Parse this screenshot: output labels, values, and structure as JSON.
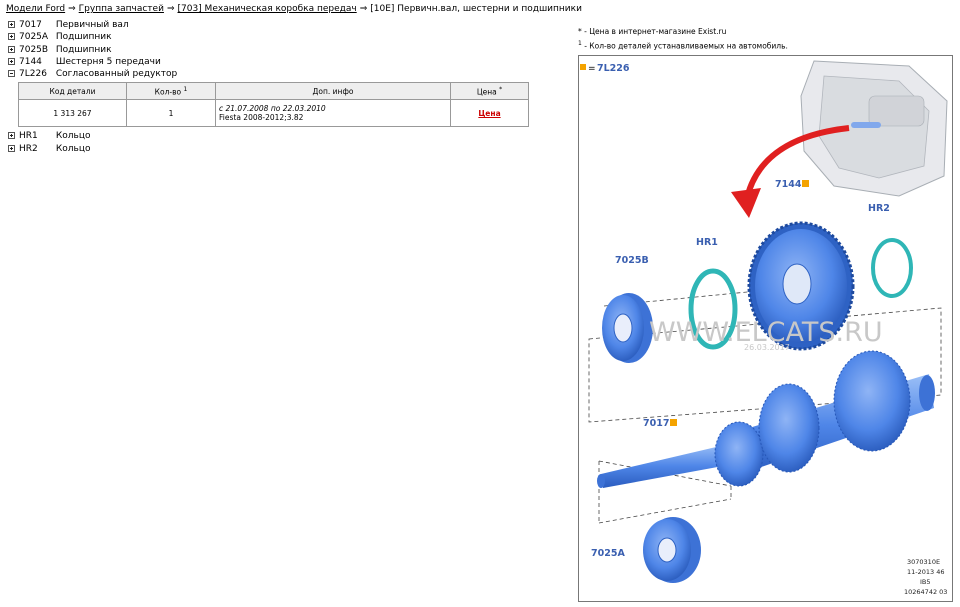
{
  "breadcrumb": {
    "items": [
      "Модели Ford",
      "Группа запчастей",
      "[703] Механическая коробка передач",
      "[10E] Первичн.вал, шестерни и подшипники"
    ],
    "separator": "⇒"
  },
  "tree": {
    "before": [
      {
        "code": "7017",
        "name": "Первичный вал"
      },
      {
        "code": "7025A",
        "name": "Подшипник"
      },
      {
        "code": "7025B",
        "name": "Подшипник"
      },
      {
        "code": "7144",
        "name": "Шестерня 5 передачи"
      }
    ],
    "expanded": {
      "code": "7L226",
      "name": "Согласованный редуктор"
    },
    "after": [
      {
        "code": "HR1",
        "name": "Кольцо"
      },
      {
        "code": "HR2",
        "name": "Кольцо"
      }
    ]
  },
  "parts_table": {
    "headers": {
      "code": "Код детали",
      "qty": "Кол-во",
      "qty_sup": "1",
      "info": "Доп. инфо",
      "price": "Цена",
      "price_sup": "*"
    },
    "row": {
      "code": "1 313 267",
      "qty": "1",
      "info_line1": "с 21.07.2008 по 22.03.2010",
      "info_line2": "Fiesta 2008-2012;3.82",
      "price": "Цена"
    }
  },
  "legend": {
    "price_mark": "*",
    "price_note": "- Цена в интернет-магазине Exist.ru",
    "qty_mark": "1",
    "qty_note": "- Кол-во деталей устанавливаемых на автомобиль."
  },
  "diagram": {
    "assembly_label": "7L226",
    "assembly_eq": "=",
    "labels": {
      "l7144": "7144",
      "lHR2": "HR2",
      "lHR1": "HR1",
      "l7025B": "7025B",
      "l7017": "7017",
      "l7025A": "7025A"
    },
    "watermark": "WWW.ELCATS.RU",
    "watermark_date": "26.03.2017",
    "ref_lines": [
      "3070310E",
      "11-2013 46",
      "IB5",
      "10264742 03"
    ],
    "colors": {
      "part": "#4f86e8",
      "ring": "#2fb6b6",
      "marker": "#f4a300",
      "label": "#3a5fb0",
      "arrow": "#e02020"
    }
  }
}
